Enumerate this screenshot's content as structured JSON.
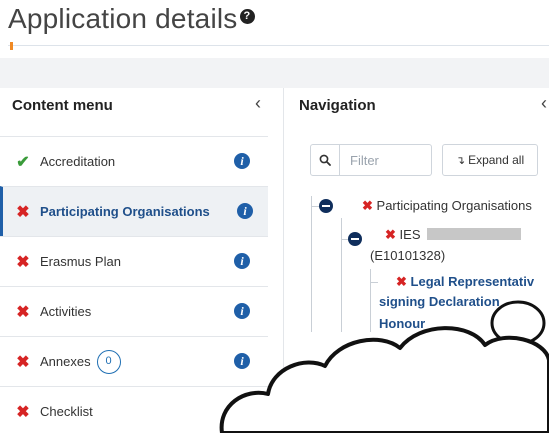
{
  "page": {
    "title": "Application details",
    "help_icon": "question-circle-icon"
  },
  "content_menu": {
    "title": "Content menu",
    "collapse_icon": "chevron-left-icon",
    "items": [
      {
        "label": "Accreditation",
        "status": "ok",
        "status_symbol": "✔",
        "info_icon": "info-icon"
      },
      {
        "label": "Participating Organisations",
        "status": "error",
        "status_symbol": "✖",
        "info_icon": "info-icon",
        "active": true
      },
      {
        "label": "Erasmus Plan",
        "status": "error",
        "status_symbol": "✖",
        "info_icon": "info-icon"
      },
      {
        "label": "Activities",
        "status": "error",
        "status_symbol": "✖",
        "info_icon": "info-icon"
      },
      {
        "label": "Annexes",
        "status": "error",
        "status_symbol": "✖",
        "badge": "0",
        "info_icon": "info-icon"
      },
      {
        "label": "Checklist",
        "status": "error",
        "status_symbol": "✖"
      }
    ]
  },
  "navigation": {
    "title": "Navigation",
    "collapse_icon": "chevron-left-icon",
    "search_icon": "search-icon",
    "filter_placeholder": "Filter",
    "expand_all_label": "Expand all",
    "tree": {
      "root_label": "Participating Organisations",
      "org_prefix": "IES",
      "org_code": "(E10101328)",
      "leaf_line1": "Legal Representativ",
      "leaf_line2": "signing Declaration",
      "leaf_line3": "Honour"
    }
  },
  "colors": {
    "ok": "#3a9b3a",
    "error": "#d62424",
    "accent": "#1f5fa8",
    "toggle": "#0f2e5c"
  }
}
